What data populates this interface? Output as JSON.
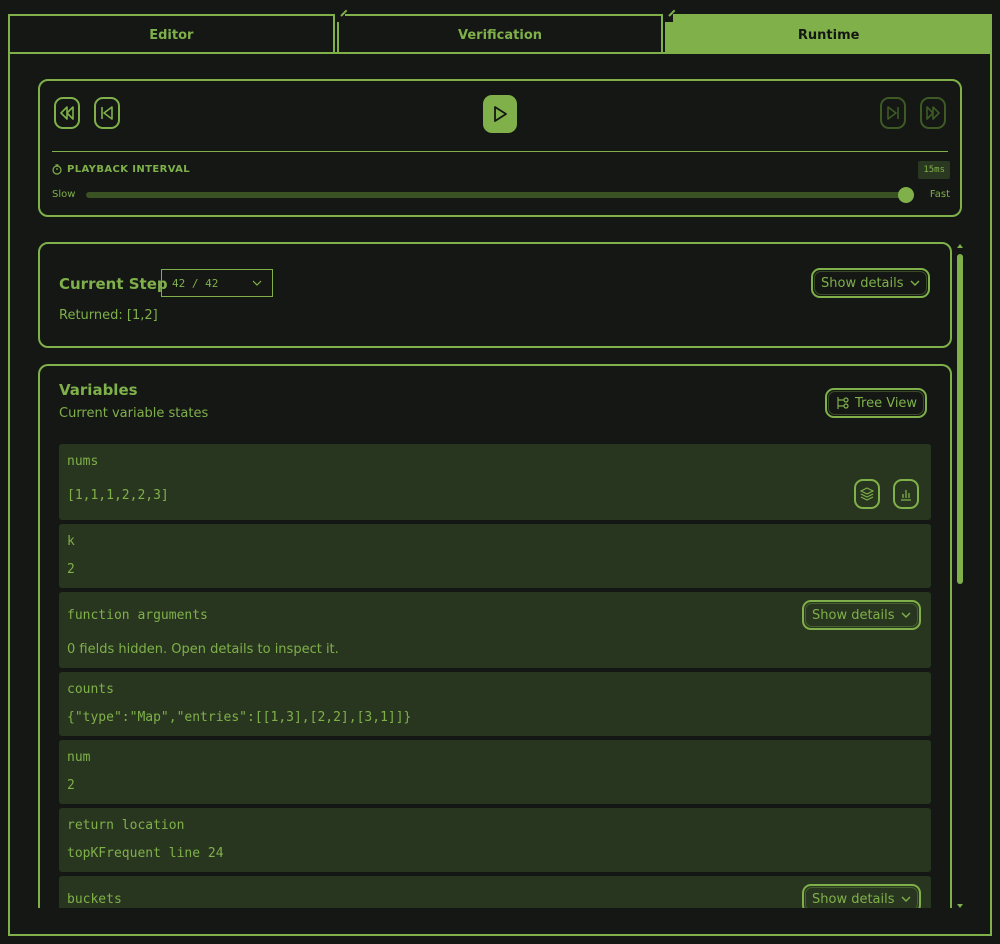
{
  "tabs": [
    {
      "label": "Editor",
      "active": false
    },
    {
      "label": "Verification",
      "active": false
    },
    {
      "label": "Runtime",
      "active": true
    }
  ],
  "playback": {
    "interval_label": "PLAYBACK INTERVAL",
    "interval_value": "15ms",
    "slow_label": "Slow",
    "fast_label": "Fast",
    "slider_fraction": 0.99
  },
  "step": {
    "title": "Current Step",
    "selected": "42 / 42",
    "returned": "Returned: [1,2]",
    "details_label": "Show details"
  },
  "variables": {
    "title": "Variables",
    "subtitle": "Current variable states",
    "tree_view_label": "Tree View",
    "items": [
      {
        "name": "nums",
        "value": "[1,1,1,2,2,3]"
      },
      {
        "name": "k",
        "value": "2"
      },
      {
        "name": "function arguments",
        "note": "0 fields hidden. Open details to inspect it.",
        "details_label": "Show details"
      },
      {
        "name": "counts",
        "value": "{\"type\":\"Map\",\"entries\":[[1,3],[2,2],[3,1]]}"
      },
      {
        "name": "num",
        "value": "2"
      },
      {
        "name": "return location",
        "value": "topKFrequent line 24"
      },
      {
        "name": "buckets",
        "details_label": "Show details"
      }
    ]
  },
  "colors": {
    "accent": "#7fb04a",
    "background": "#151715",
    "card": "#29361f",
    "dim": "#3d5a25"
  }
}
